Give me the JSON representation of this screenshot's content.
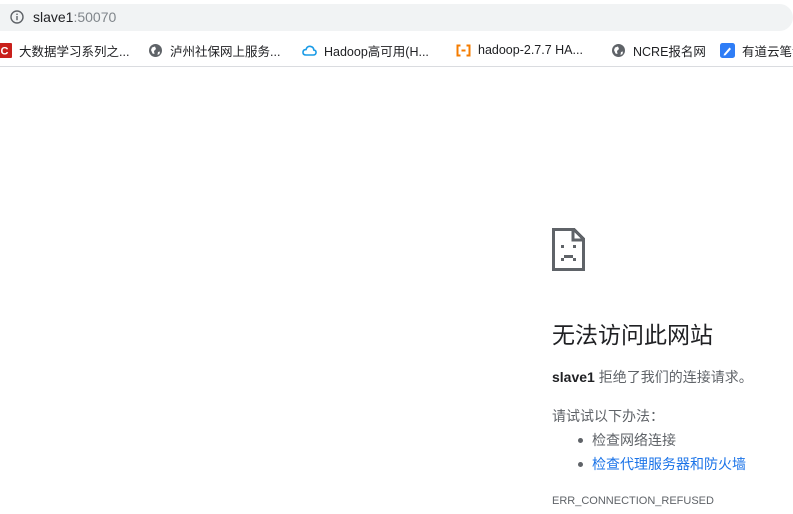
{
  "omnibox": {
    "host": "slave1",
    "port": ":50070",
    "icon": "info-icon"
  },
  "bookmarks": [
    {
      "label": "大数据学习系列之...",
      "icon": "csdn-icon",
      "color": "#c9201b"
    },
    {
      "label": "泸州社保网上服务...",
      "icon": "globe-icon",
      "color": "#5f6368"
    },
    {
      "label": "Hadoop高可用(H...",
      "icon": "cloud-icon",
      "color": "#1a9be6"
    },
    {
      "label": "hadoop-2.7.7 HA...",
      "icon": "bracket-icon",
      "color": "#f57c00"
    },
    {
      "label": "NCRE报名网",
      "icon": "globe-icon",
      "color": "#5f6368"
    },
    {
      "label": "有道云笔记",
      "icon": "youdao-icon",
      "color": "#2f7df6"
    }
  ],
  "error": {
    "icon": "sad-page-icon",
    "title": "无法访问此网站",
    "host": "slave1",
    "message": " 拒绝了我们的连接请求。",
    "suggest_intro": "请试试以下办法：",
    "suggestions": [
      {
        "label": "检查网络连接",
        "link": false
      },
      {
        "label": "检查代理服务器和防火墙",
        "link": true
      }
    ],
    "code": "ERR_CONNECTION_REFUSED"
  },
  "colors": {
    "link": "#1a73e8",
    "text": "#202124",
    "secondary": "#5f6368"
  }
}
